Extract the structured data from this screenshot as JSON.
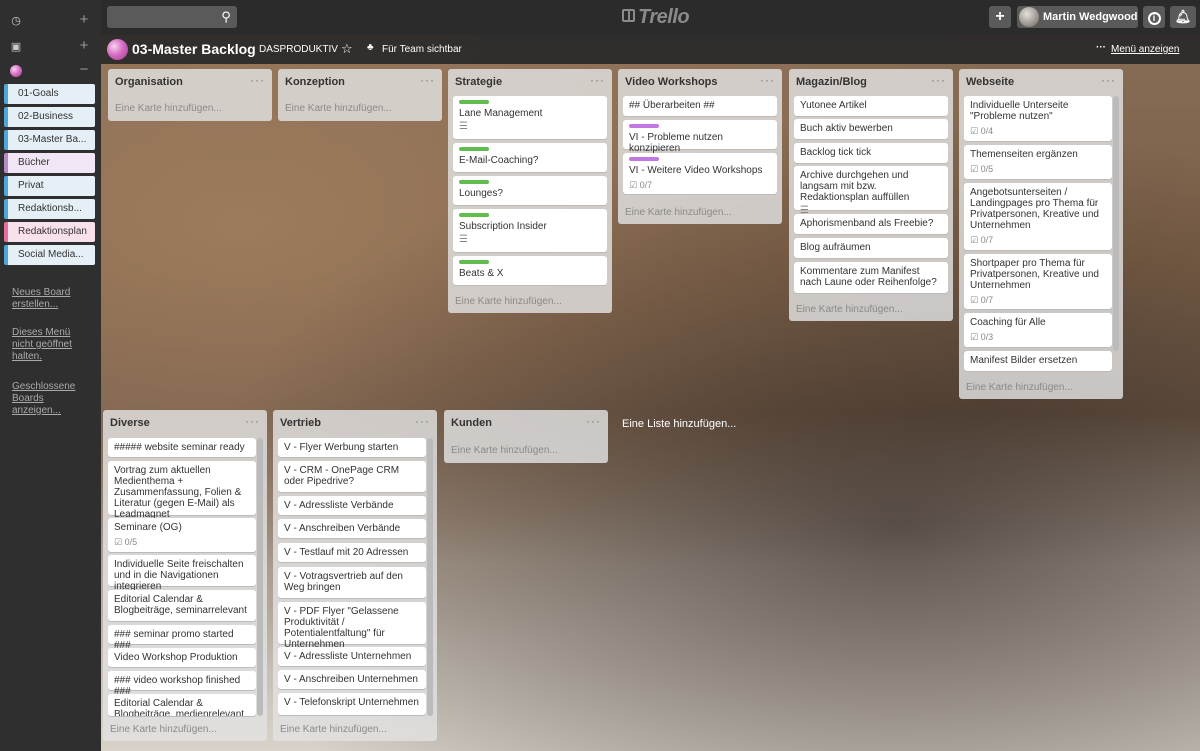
{
  "header": {
    "search_placeholder": "",
    "search_icon": "magnifier-icon",
    "logo_text": "Trello",
    "add_label": "+",
    "user_name": "Martin Wedgwood",
    "info_label": "i",
    "bell_icon": "bell-icon"
  },
  "sidebar": {
    "recent_icon": "clock-icon",
    "boards_icon": "board-icon",
    "org_icon": "org-icon",
    "plus": "+",
    "minus": "−",
    "boards": [
      {
        "label": "01-Goals",
        "color": "#4fa6d8"
      },
      {
        "label": "02-Business",
        "color": "#4fa6d8"
      },
      {
        "label": "03-Master Ba...",
        "color": "#4fa6d8"
      },
      {
        "label": "Bücher",
        "color": "#b58cc6"
      },
      {
        "label": "Privat",
        "color": "#4fa6d8"
      },
      {
        "label": "Redaktionsb...",
        "color": "#4fa6d8"
      },
      {
        "label": "Redaktionsplan",
        "color": "#e56fa2"
      },
      {
        "label": "Social Media...",
        "color": "#4fa6d8"
      }
    ],
    "links": [
      "Neues Board erstellen...",
      "Dieses Menü nicht geöffnet halten.",
      "Geschlossene Boards anzeigen..."
    ]
  },
  "board": {
    "title": "03-Master Backlog",
    "team": "DASPRODUKTIV",
    "star": "☆",
    "visibility": "Für Team sichtbar",
    "menu_label": "Menü anzeigen",
    "menu_dots": "···"
  },
  "colors": {
    "label_green": "#61bd4f",
    "label_purple": "#c377e0"
  },
  "add_card_label": "Eine Karte hinzufügen...",
  "add_list_label": "Eine Liste hinzufügen...",
  "lists": [
    {
      "title": "Organisation",
      "cards": []
    },
    {
      "title": "Konzeption",
      "cards": []
    },
    {
      "title": "Strategie",
      "cards": [
        {
          "title": "Lane Management"
        },
        {
          "title": "E-Mail-Coaching?"
        },
        {
          "title": "Lounges?"
        },
        {
          "title": "Subscription Insider"
        },
        {
          "title": "Beats & X"
        }
      ]
    },
    {
      "title": "Video Workshops",
      "cards": [
        {
          "title": "## Überarbeiten ##"
        },
        {
          "title": "VI - Probleme nutzen konzipieren"
        },
        {
          "title": "VI - Weitere Video Workshops",
          "badge": "0/7"
        }
      ]
    },
    {
      "title": "Magazin/Blog",
      "cards": [
        {
          "title": "Yutonee Artikel"
        },
        {
          "title": "Buch aktiv bewerben"
        },
        {
          "title": "Backlog tick tick"
        },
        {
          "title": "Archive durchgehen und langsam mit bzw. Redaktionsplan auffüllen"
        },
        {
          "title": "Aphorismenband als Freebie?"
        },
        {
          "title": "Blog aufräumen"
        },
        {
          "title": "Kommentare zum Manifest nach Laune oder Reihenfolge?"
        }
      ]
    },
    {
      "title": "Webseite",
      "cards": [
        {
          "title": "Individuelle Unterseite \"Probleme nutzen\"",
          "badge": "0/4"
        },
        {
          "title": "Themenseiten ergänzen",
          "badge": "0/5"
        },
        {
          "title": "Angebotsunterseiten / Landingpages pro Thema für Privatpersonen, Kreative und Unternehmen",
          "badge": "0/7"
        },
        {
          "title": "Shortpaper pro Thema für Privatpersonen, Kreative und Unternehmen",
          "badge": "0/7"
        },
        {
          "title": "Coaching für Alle",
          "badge": "0/3"
        },
        {
          "title": "Manifest Bilder ersetzen"
        }
      ]
    },
    {
      "title": "Diverse",
      "cards": [
        {
          "title": "##### website seminar ready"
        },
        {
          "title": "Vortrag zum aktuellen Medienthema + Zusammenfassung, Folien & Literatur (gegen E-Mail) als Leadmagnet"
        },
        {
          "title": "Seminare (OG)",
          "badge": "0/5"
        },
        {
          "title": "Individuelle Seite freischalten und in die Navigationen integrieren"
        },
        {
          "title": "Editorial Calendar & Blogbeiträge, seminarrelevant"
        },
        {
          "title": "### seminar promo started ###"
        },
        {
          "title": "Video Workshop Produktion"
        },
        {
          "title": "### video workshop finished ###"
        },
        {
          "title": "Editorial Calendar & Blogbeiträge, medienrelevant"
        }
      ]
    },
    {
      "title": "Vertrieb",
      "cards": [
        {
          "title": "V - Flyer Werbung starten"
        },
        {
          "title": "V - CRM - OnePage CRM oder Pipedrive?"
        },
        {
          "title": "V - Adressliste Verbände"
        },
        {
          "title": "V - Anschreiben Verbände"
        },
        {
          "title": "V - Testlauf mit 20 Adressen"
        },
        {
          "title": "V - Votragsvertrieb auf den Weg bringen"
        },
        {
          "title": "V - PDF Flyer \"Gelassene Produktivität / Potentialentfaltung\" für Unternehmen"
        },
        {
          "title": "V - Adressliste Unternehmen"
        },
        {
          "title": "V - Anschreiben Unternehmen"
        },
        {
          "title": "V - Telefonskript Unternehmen"
        }
      ]
    },
    {
      "title": "Kunden",
      "cards": []
    }
  ]
}
